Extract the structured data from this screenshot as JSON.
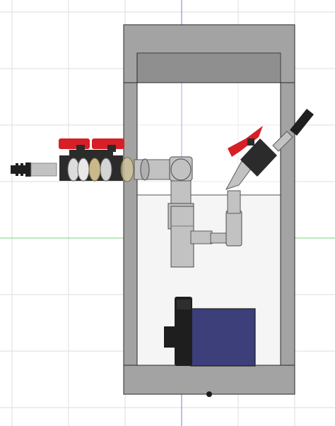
{
  "viewport": {
    "background": "#ffffff",
    "grid_color": "#dddddd",
    "x_axis_color": "#7cd07c",
    "y_axis_color": "#7a7ae6"
  },
  "model": {
    "colors": {
      "tank_wall": "#a3a3a3",
      "tank_wall_dark": "#8f8f8f",
      "outline": "#2a2a2a",
      "water": "#f5f5f5",
      "pipe": "#c2c2c2",
      "pipe_dark": "#8a8a8a",
      "valve_body": "#2b2b2b",
      "valve_handle": "#d61f26",
      "pump_motor": "#3d3f7a",
      "pump_head": "#1e1e1e",
      "union_clear": "#dcdcdc",
      "union_amber": "#c9b98a"
    },
    "icons": [
      "origin-point-icon"
    ]
  }
}
